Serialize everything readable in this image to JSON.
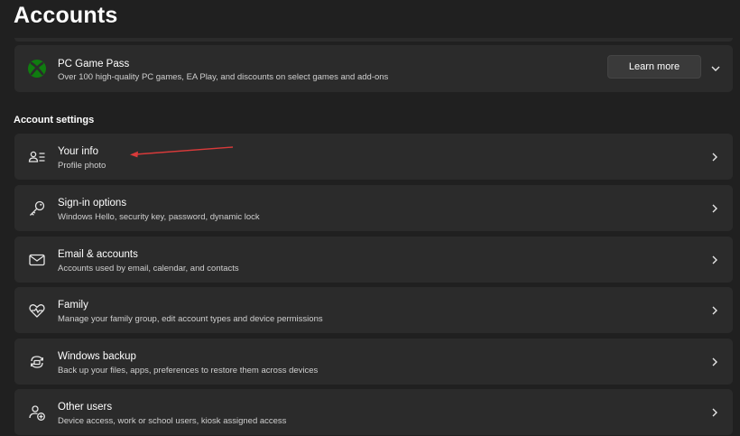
{
  "page": {
    "title": "Accounts"
  },
  "promo": {
    "title": "PC Game Pass",
    "subtitle": "Over 100 high-quality PC games, EA Play, and discounts on select games and add-ons",
    "button_label": "Learn more",
    "icon": "xbox-icon",
    "accent": "#107c10"
  },
  "section": {
    "title": "Account settings"
  },
  "items": [
    {
      "title": "Your info",
      "subtitle": "Profile photo",
      "icon": "person-list-icon"
    },
    {
      "title": "Sign-in options",
      "subtitle": "Windows Hello, security key, password, dynamic lock",
      "icon": "key-icon"
    },
    {
      "title": "Email & accounts",
      "subtitle": "Accounts used by email, calendar, and contacts",
      "icon": "mail-icon"
    },
    {
      "title": "Family",
      "subtitle": "Manage your family group, edit account types and device permissions",
      "icon": "heart-icon"
    },
    {
      "title": "Windows backup",
      "subtitle": "Back up your files, apps, preferences to restore them across devices",
      "icon": "backup-icon"
    },
    {
      "title": "Other users",
      "subtitle": "Device access, work or school users, kiosk assigned access",
      "icon": "add-user-icon"
    }
  ],
  "annotation": {
    "color": "#d93a3a"
  }
}
